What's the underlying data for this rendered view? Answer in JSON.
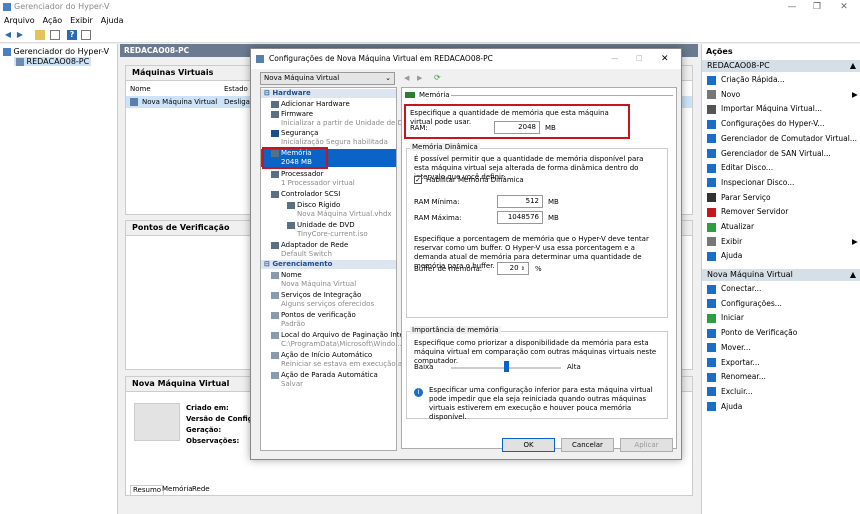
{
  "window": {
    "title": "Gerenciador do Hyper-V"
  },
  "menu": [
    "Arquivo",
    "Ação",
    "Exibir",
    "Ajuda"
  ],
  "tree": {
    "root": "Gerenciador do Hyper-V",
    "child": "REDACAO08-PC"
  },
  "center": {
    "header": "REDACAO08-PC",
    "vm_pane_title": "Máquinas Virtuais",
    "col_name": "Nome",
    "col_state": "Estado",
    "vm_name": "Nova Máquina Virtual",
    "vm_state": "Desligada",
    "checkpoints_title": "Pontos de Verificação",
    "details_title": "Nova Máquina Virtual",
    "details_labels": [
      "Criado em:",
      "Versão de Configur",
      "Geração:",
      "Observações:"
    ],
    "details_tabs": [
      "Resumo",
      "Memória",
      "Rede"
    ]
  },
  "actions": {
    "title": "Ações",
    "section1": "REDACAO08-PC",
    "items1": [
      "Criação Rápida...",
      "Novo",
      "Importar Máquina Virtual...",
      "Configurações do Hyper-V...",
      "Gerenciador de Comutador Virtual...",
      "Gerenciador de SAN Virtual...",
      "Editar Disco...",
      "Inspecionar Disco...",
      "Parar Serviço",
      "Remover Servidor",
      "Atualizar",
      "Exibir",
      "Ajuda"
    ],
    "section2": "Nova Máquina Virtual",
    "items2": [
      "Conectar...",
      "Configurações...",
      "Iniciar",
      "Ponto de Verificação",
      "Mover...",
      "Exportar...",
      "Renomear...",
      "Excluir...",
      "Ajuda"
    ]
  },
  "dialog": {
    "title": "Configurações de Nova Máquina Virtual em REDACAO08-PC",
    "vm_select": "Nova Máquina Virtual",
    "hardware_header": "Hardware",
    "hardware": [
      {
        "label": "Adicionar Hardware",
        "sub": ""
      },
      {
        "label": "Firmware",
        "sub": "Inicializar a partir de Unidade de DVD"
      },
      {
        "label": "Segurança",
        "sub": "Inicialização Segura habilitada"
      },
      {
        "label": "Memória",
        "sub": "2048 MB"
      },
      {
        "label": "Processador",
        "sub": "1 Processador virtual"
      },
      {
        "label": "Controlador SCSI",
        "sub": ""
      },
      {
        "label": "Disco Rígido",
        "sub": "Nova Máquina Virtual.vhdx"
      },
      {
        "label": "Unidade de DVD",
        "sub": "TinyCore-current.iso"
      },
      {
        "label": "Adaptador de Rede",
        "sub": "Default Switch"
      }
    ],
    "mgmt_header": "Gerenciamento",
    "management": [
      {
        "label": "Nome",
        "sub": "Nova Máquina Virtual"
      },
      {
        "label": "Serviços de Integração",
        "sub": "Alguns serviços oferecidos"
      },
      {
        "label": "Pontos de verificação",
        "sub": "Padrão"
      },
      {
        "label": "Local do Arquivo de Paginação Inte...",
        "sub": "C:\\ProgramData\\Microsoft\\Windo..."
      },
      {
        "label": "Ação de Início Automático",
        "sub": "Reiniciar se estava em execução a..."
      },
      {
        "label": "Ação de Parada Automática",
        "sub": "Salvar"
      }
    ],
    "memory_header": "Memória",
    "memory_desc": "Especifique a quantidade de memória que esta máquina virtual pode usar.",
    "ram_label": "RAM:",
    "ram_value": "2048",
    "mb": "MB",
    "dyn_group": "Memória Dinâmica",
    "dyn_desc": "É possível permitir que a quantidade de memória disponível para esta máquina virtual seja alterada de forma dinâmica dentro do intervalo que você definir.",
    "dyn_enable": "Habilitar Memória Dinâmica",
    "ram_min_label": "RAM Mínima:",
    "ram_min_value": "512",
    "ram_max_label": "RAM Máxima:",
    "ram_max_value": "1048576",
    "buffer_desc": "Especifique a porcentagem de memória que o Hyper-V deve tentar reservar como um buffer. O Hyper-V usa essa porcentagem e a demanda atual de memória para determinar uma quantidade de memória para o buffer.",
    "buffer_label": "Buffer de memória:",
    "buffer_value": "20",
    "pct": "%",
    "weight_group": "Importância de memória",
    "weight_desc": "Especifique como priorizar a disponibilidade da memória para esta máquina virtual em comparação com outras máquinas virtuais neste computador.",
    "low": "Baixa",
    "high": "Alta",
    "slider_level": 0.5,
    "info": "Especificar uma configuração inferior para esta máquina virtual pode impedir que ela seja reiniciada quando outras máquinas virtuais estiverem em execução e houver pouca memória disponível.",
    "ok": "OK",
    "cancel": "Cancelar",
    "apply": "Aplicar"
  }
}
